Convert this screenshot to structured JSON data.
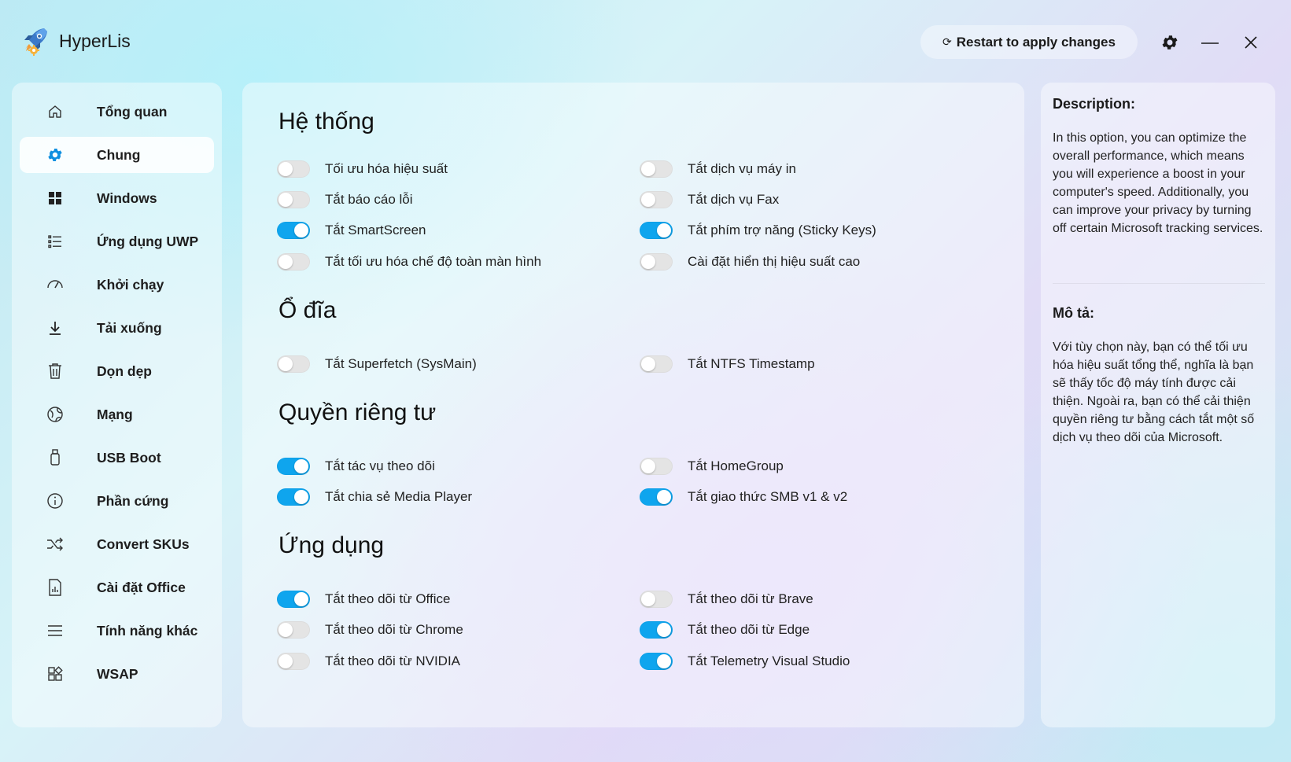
{
  "app": {
    "title": "HyperLis",
    "restart_icon": "⟳",
    "restart_label": "Restart to apply changes",
    "icons": {
      "settings": "gear-icon",
      "minimize": "minimize-icon",
      "close": "close-icon",
      "logo": "rocket-gear-logo"
    }
  },
  "sidebar": {
    "items": [
      {
        "label": "Tổng quan",
        "icon": "home-icon",
        "active": false
      },
      {
        "label": "Chung",
        "icon": "gear-icon",
        "active": true
      },
      {
        "label": "Windows",
        "icon": "windows-icon",
        "active": false
      },
      {
        "label": "Ứng dụng UWP",
        "icon": "list-icon",
        "active": false
      },
      {
        "label": "Khởi chạy",
        "icon": "speedometer-icon",
        "active": false
      },
      {
        "label": "Tải xuống",
        "icon": "download-icon",
        "active": false
      },
      {
        "label": "Dọn dẹp",
        "icon": "trash-icon",
        "active": false
      },
      {
        "label": "Mạng",
        "icon": "globe-icon",
        "active": false
      },
      {
        "label": "USB Boot",
        "icon": "usb-icon",
        "active": false
      },
      {
        "label": "Phần cứng",
        "icon": "info-icon",
        "active": false
      },
      {
        "label": "Convert SKUs",
        "icon": "shuffle-icon",
        "active": false
      },
      {
        "label": "Cài đặt Office",
        "icon": "office-icon",
        "active": false
      },
      {
        "label": "Tính năng khác",
        "icon": "menu-icon",
        "active": false
      },
      {
        "label": "WSAP",
        "icon": "apps-icon",
        "active": false
      }
    ]
  },
  "sections": [
    {
      "title": "Hệ thống",
      "options": [
        {
          "label": "Tối ưu hóa hiệu suất",
          "on": false
        },
        {
          "label": "Tắt dịch vụ máy in",
          "on": false
        },
        {
          "label": "Tắt báo cáo lỗi",
          "on": false
        },
        {
          "label": "Tắt dịch vụ Fax",
          "on": false
        },
        {
          "label": "Tắt SmartScreen",
          "on": true
        },
        {
          "label": "Tắt phím trợ năng (Sticky Keys)",
          "on": true
        },
        {
          "label": "Tắt tối ưu hóa chế độ toàn màn hình",
          "on": false
        },
        {
          "label": "Cài đặt hiển thị hiệu suất cao",
          "on": false
        }
      ]
    },
    {
      "title": "Ổ đĩa",
      "options": [
        {
          "label": "Tắt Superfetch (SysMain)",
          "on": false
        },
        {
          "label": "Tắt NTFS Timestamp",
          "on": false
        }
      ]
    },
    {
      "title": "Quyền riêng tư",
      "options": [
        {
          "label": "Tắt tác vụ theo dõi",
          "on": true
        },
        {
          "label": "Tắt HomeGroup",
          "on": false
        },
        {
          "label": "Tắt chia sẻ Media Player",
          "on": true
        },
        {
          "label": "Tắt giao thức SMB v1 & v2",
          "on": true
        }
      ]
    },
    {
      "title": "Ứng dụng",
      "options": [
        {
          "label": "Tắt theo dõi từ Office",
          "on": true
        },
        {
          "label": "Tắt theo dõi từ Brave",
          "on": false
        },
        {
          "label": "Tắt theo dõi từ Chrome",
          "on": false
        },
        {
          "label": "Tắt theo dõi từ Edge",
          "on": true
        },
        {
          "label": "Tắt theo dõi từ NVIDIA",
          "on": false
        },
        {
          "label": "Tắt Telemetry Visual Studio",
          "on": true
        }
      ]
    }
  ],
  "description": {
    "en_title": "Description:",
    "en_text": "In this option, you can optimize the overall performance, which means you will experience a boost in your computer's speed. Additionally, you can improve your privacy by turning off certain Microsoft tracking services.",
    "vi_title": "Mô tả:",
    "vi_text": "Với tùy chọn này, bạn có thể tối ưu hóa hiệu suất tổng thể, nghĩa là bạn sẽ thấy tốc độ máy tính được cải thiện. Ngoài ra, bạn có thể cải thiện quyền riêng tư bằng cách tắt một số dịch vụ theo dõi của Microsoft."
  },
  "colors": {
    "accent": "#0fa5ee",
    "toggle_off": "#e4e4e4"
  }
}
